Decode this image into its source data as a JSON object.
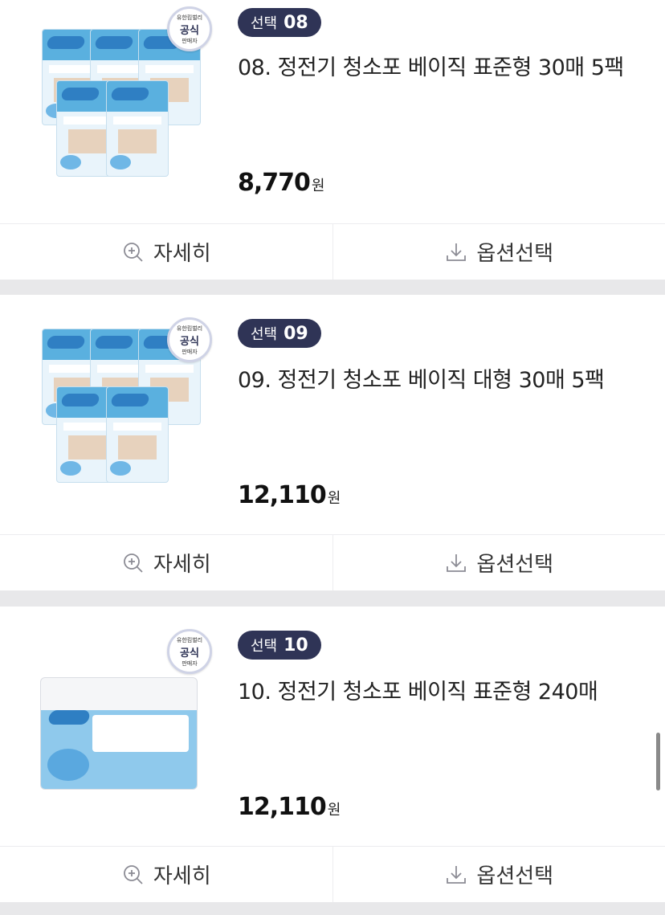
{
  "colors": {
    "badge_bg": "#2f3456",
    "top_accent": "#e84a4a",
    "page_bg": "#e8e8ea"
  },
  "products": [
    {
      "badge_label": "선택",
      "badge_number": "08",
      "title": "08. 정전기 청소포 베이직 표준형 30매 5팩",
      "price": "8,770",
      "currency": "원",
      "detail_label": "자세히",
      "option_label": "옵션선택",
      "seal": {
        "line1": "유한킴벌리",
        "line2": "공식",
        "line3": "판매자"
      }
    },
    {
      "badge_label": "선택",
      "badge_number": "09",
      "title": "09. 정전기 청소포 베이직 대형 30매 5팩",
      "price": "12,110",
      "currency": "원",
      "detail_label": "자세히",
      "option_label": "옵션선택",
      "seal": {
        "line1": "유한킴벌리",
        "line2": "공식",
        "line3": "판매자"
      }
    },
    {
      "badge_label": "선택",
      "badge_number": "10",
      "title": "10. 정전기 청소포 베이직 표준형 240매",
      "price": "12,110",
      "currency": "원",
      "detail_label": "자세히",
      "option_label": "옵션선택",
      "seal": {
        "line1": "유한킴벌리",
        "line2": "공식",
        "line3": "판매자"
      }
    }
  ],
  "icons": {
    "detail": "zoom-in-icon",
    "option": "download-icon"
  }
}
